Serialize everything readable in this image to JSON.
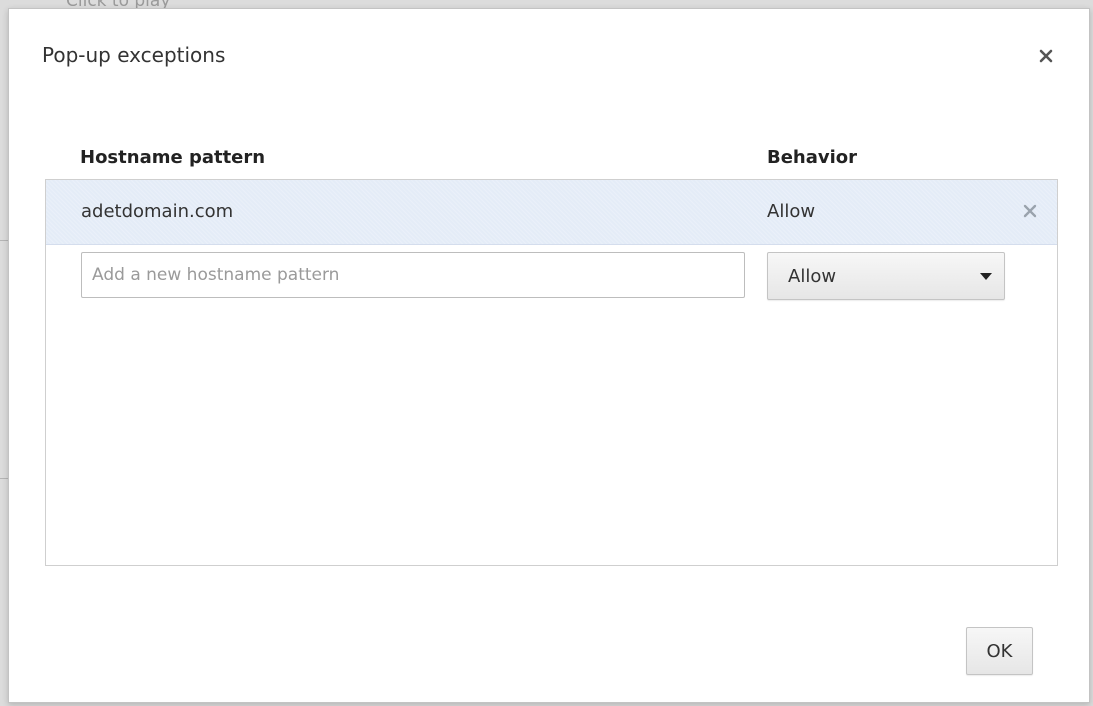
{
  "background": {
    "partial_text": "Click to play"
  },
  "dialog": {
    "title": "Pop-up exceptions",
    "close_icon": "close-icon"
  },
  "table": {
    "headers": {
      "hostname": "Hostname pattern",
      "behavior": "Behavior"
    },
    "rows": [
      {
        "hostname": "adetdomain.com",
        "behavior": "Allow",
        "remove_icon": "remove-icon"
      }
    ],
    "new_entry": {
      "placeholder": "Add a new hostname pattern",
      "value": "",
      "behavior_selected": "Allow",
      "dropdown_icon": "chevron-down-icon"
    }
  },
  "footer": {
    "ok_label": "OK"
  },
  "colors": {
    "selected_row": "#e4ecf7",
    "border": "#c3c3c3",
    "text": "#333333",
    "button_top": "#f7f7f7",
    "button_bottom": "#e6e6e6"
  }
}
